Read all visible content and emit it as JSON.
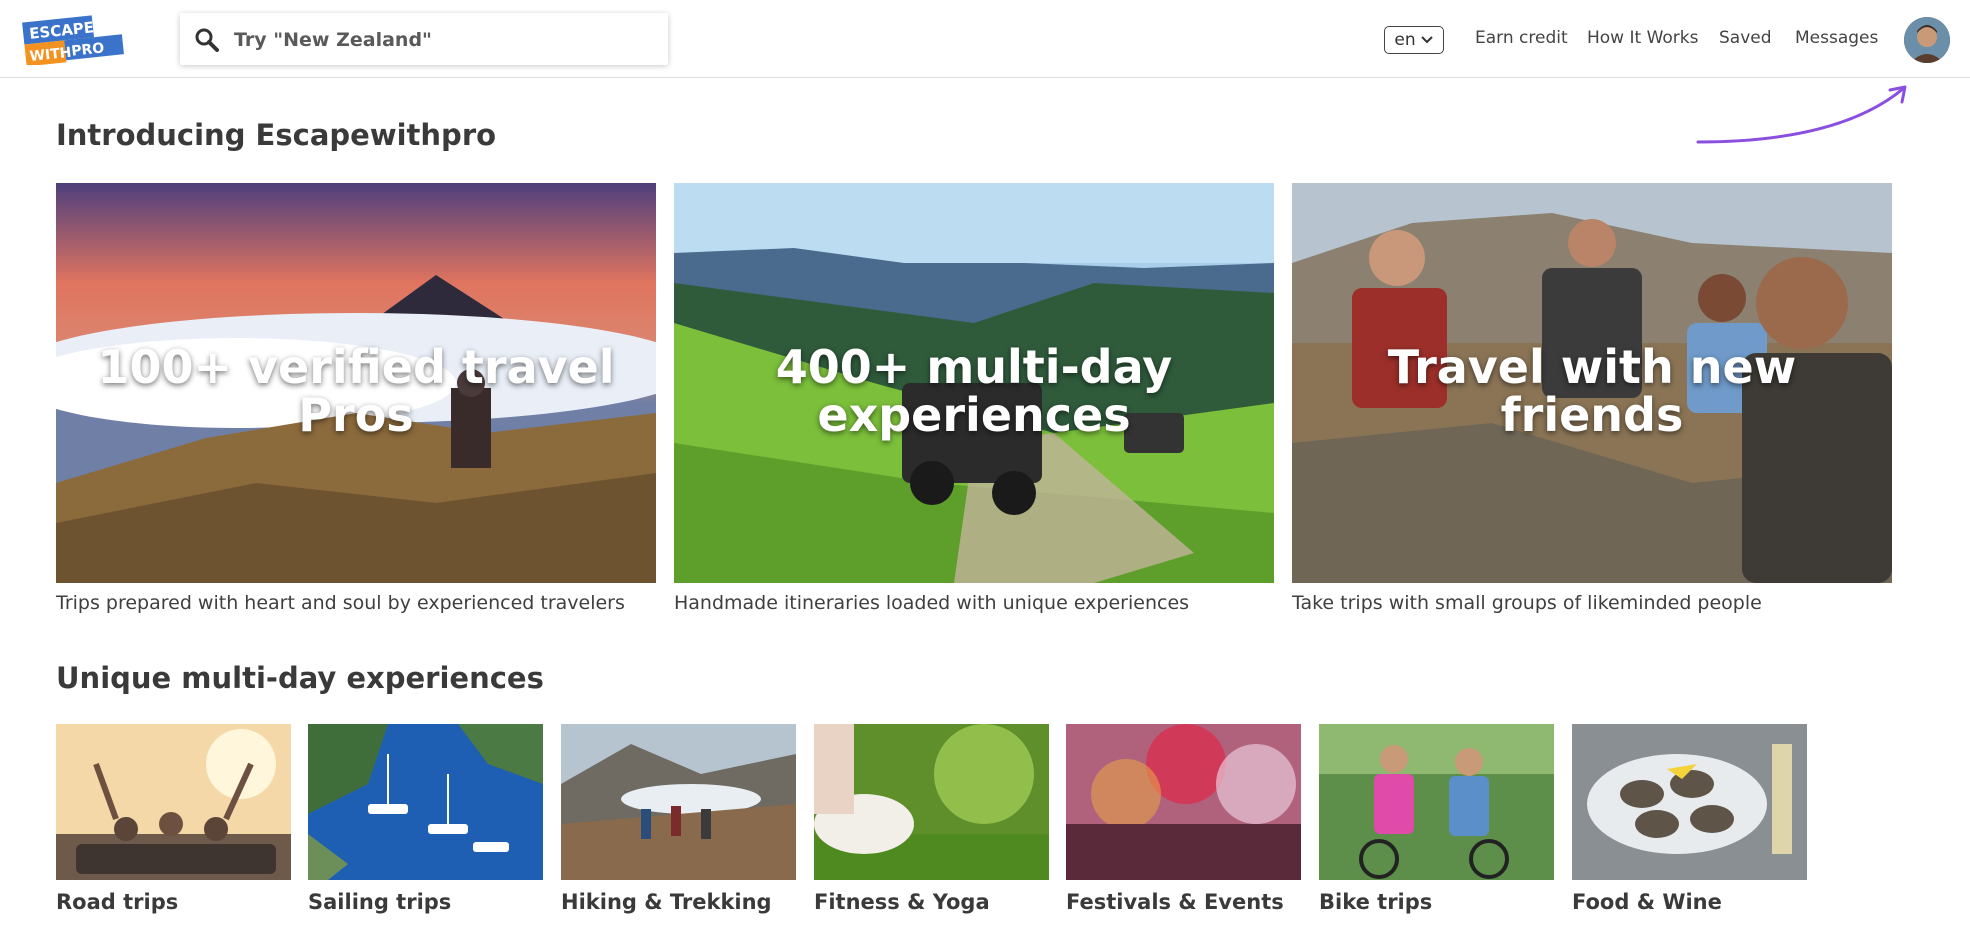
{
  "header": {
    "logo": {
      "line1": "ESCAPE",
      "line2": "WITH",
      "line3": "PRO"
    },
    "search": {
      "placeholder": "Try \"New Zealand\"",
      "icon": "search-icon"
    },
    "language": {
      "value": "en",
      "icon": "chevron-down-icon"
    },
    "nav": [
      "Earn credit",
      "How It Works",
      "Saved",
      "Messages"
    ],
    "avatar": "user-avatar"
  },
  "intro": {
    "title": "Introducing Escapewithpro",
    "features": [
      {
        "overlay": "100+ verified travel Pros",
        "caption": "Trips prepared with heart and soul by experienced travelers"
      },
      {
        "overlay": "400+ multi-day experiences",
        "caption": "Handmade itineraries loaded with unique experiences"
      },
      {
        "overlay": "Travel with new friends",
        "caption": "Take trips with small groups of likeminded people"
      }
    ]
  },
  "experiences": {
    "title": "Unique multi-day experiences",
    "categories": [
      {
        "label": "Road trips"
      },
      {
        "label": "Sailing trips"
      },
      {
        "label": "Hiking & Trekking"
      },
      {
        "label": "Fitness & Yoga"
      },
      {
        "label": "Festivals & Events"
      },
      {
        "label": "Bike trips"
      },
      {
        "label": "Food & Wine"
      }
    ]
  },
  "colors": {
    "accent_arrow": "#8a4fe0",
    "logo_blue": "#3a73c9",
    "logo_orange": "#f39221"
  }
}
